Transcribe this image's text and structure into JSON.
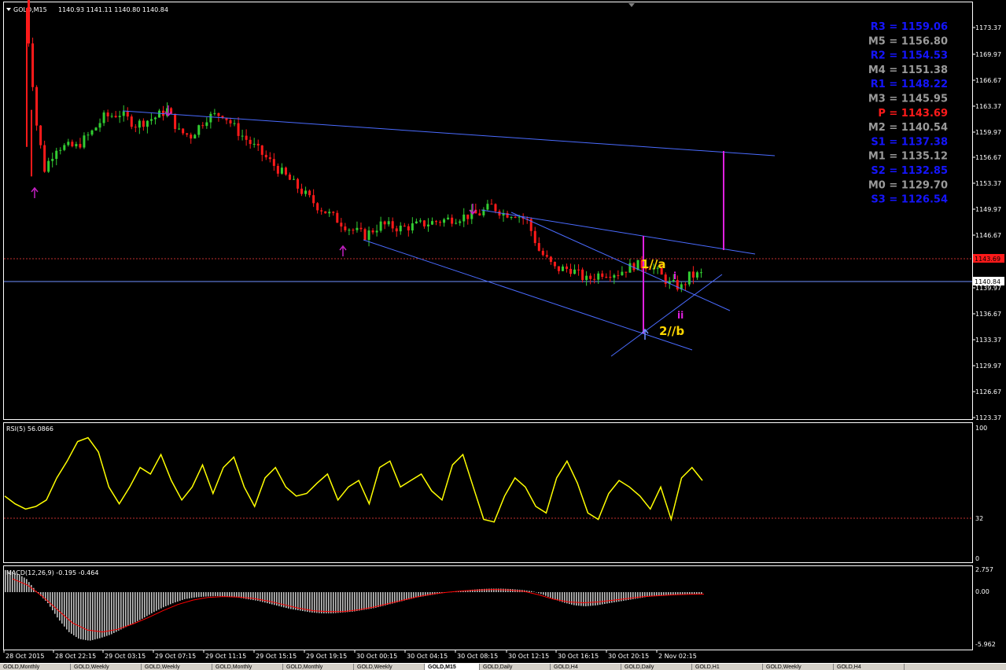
{
  "header": {
    "symbol": "GOLD,M15",
    "ohlc": "1140.93 1141.11 1140.80 1140.84"
  },
  "colors": {
    "background": "#000000",
    "grid_frame": "#ffffff",
    "bull": "#32cd32",
    "bear": "#ff1a1a",
    "trendline": "#4a6bff",
    "magenta": "#e020e0",
    "yellow_label": "#ffd700",
    "pivot_blue": "#1515ff",
    "pivot_gray": "#9a9a9a",
    "pivot_red": "#ff1a1a",
    "rsi": "#ffff00",
    "macd_hist": "#c0c0c0",
    "macd_signal": "#ff0000",
    "price_line": "#6f8fff",
    "level_dotted": "#c03030"
  },
  "pivots": [
    {
      "label": "R3",
      "value": "1159.06",
      "color": "blue"
    },
    {
      "label": "M5",
      "value": "1156.80",
      "color": "gray"
    },
    {
      "label": "R2",
      "value": "1154.53",
      "color": "blue"
    },
    {
      "label": "M4",
      "value": "1151.38",
      "color": "gray"
    },
    {
      "label": "R1",
      "value": "1148.22",
      "color": "blue"
    },
    {
      "label": "M3",
      "value": "1145.95",
      "color": "gray"
    },
    {
      "label": "P ",
      "value": "1143.69",
      "color": "red"
    },
    {
      "label": "M2",
      "value": "1140.54",
      "color": "gray"
    },
    {
      "label": "S1",
      "value": "1137.38",
      "color": "blue"
    },
    {
      "label": "M1",
      "value": "1135.12",
      "color": "gray"
    },
    {
      "label": "S2",
      "value": "1132.85",
      "color": "blue"
    },
    {
      "label": "M0",
      "value": "1129.70",
      "color": "gray"
    },
    {
      "label": "S3",
      "value": "1126.54",
      "color": "blue"
    }
  ],
  "price_axis": {
    "ticks": [
      "1173.37",
      "1169.97",
      "1166.67",
      "1163.37",
      "1159.97",
      "1156.67",
      "1153.37",
      "1149.97",
      "1146.67",
      "1139.97",
      "1136.67",
      "1133.37",
      "1129.97",
      "1126.67",
      "1123.37"
    ],
    "current_price": "1140.84",
    "marker_price": "1143.69"
  },
  "time_axis": {
    "labels": [
      "28 Oct 2015",
      "28 Oct 22:15",
      "29 Oct 03:15",
      "29 Oct 07:15",
      "29 Oct 11:15",
      "29 Oct 15:15",
      "29 Oct 19:15",
      "30 Oct 00:15",
      "30 Oct 04:15",
      "30 Oct 08:15",
      "30 Oct 12:15",
      "30 Oct 16:15",
      "30 Oct 20:15",
      "2 Nov 02:15"
    ]
  },
  "wave_labels": {
    "w1": "1//a",
    "w2": "2//b",
    "wi": "i",
    "wii": "ii"
  },
  "rsi": {
    "title": "RSI(5) 56.0866",
    "levels": [
      "100",
      "32",
      "0"
    ]
  },
  "macd": {
    "title": "MACD(12,26,9) -0.195 -0.464",
    "levels": [
      "2.757",
      "0.00",
      "-5.962"
    ]
  },
  "tabs": [
    "GOLD,Monthly",
    "GOLD,Weekly",
    "GOLD,Weekly",
    "GOLD,Monthly",
    "GOLD,Monthly",
    "GOLD,Weekly",
    "GOLD,M15",
    "GOLD,Daily",
    "GOLD,H4",
    "GOLD,Daily",
    "GOLD,H1",
    "GOLD,Weekly",
    "GOLD,H4"
  ],
  "active_tab": 6,
  "chart_data": {
    "type": "candlestick",
    "price_path": [
      [
        0,
        1178
      ],
      [
        3,
        1161
      ],
      [
        5,
        1155
      ],
      [
        8,
        1158
      ],
      [
        13,
        1158
      ],
      [
        17,
        1160
      ],
      [
        20,
        1162
      ],
      [
        24,
        1162.5
      ],
      [
        28,
        1161
      ],
      [
        33,
        1162
      ],
      [
        36,
        1163
      ],
      [
        39,
        1160
      ],
      [
        42,
        1159.5
      ],
      [
        46,
        1162
      ],
      [
        50,
        1162.5
      ],
      [
        54,
        1160
      ],
      [
        58,
        1158
      ],
      [
        62,
        1156
      ],
      [
        66,
        1154
      ],
      [
        70,
        1152
      ],
      [
        74,
        1150
      ],
      [
        78,
        1148.5
      ],
      [
        82,
        1147
      ],
      [
        86,
        1146
      ],
      [
        90,
        1147.5
      ],
      [
        95,
        1147
      ],
      [
        100,
        1147.5
      ],
      [
        105,
        1148
      ],
      [
        110,
        1148.5
      ],
      [
        115,
        1149
      ],
      [
        118,
        1150
      ],
      [
        121,
        1149
      ],
      [
        124,
        1149
      ],
      [
        127,
        1148
      ],
      [
        130,
        1144
      ],
      [
        134,
        1141.5
      ],
      [
        138,
        1141.5
      ],
      [
        142,
        1140
      ],
      [
        146,
        1141
      ],
      [
        150,
        1141
      ],
      [
        154,
        1142
      ],
      [
        158,
        1142
      ],
      [
        161,
        1140.5
      ],
      [
        163,
        1139.5
      ],
      [
        166,
        1139
      ],
      [
        168,
        1140.5
      ],
      [
        172,
        1140.84
      ]
    ],
    "price_range": [
      1121.5,
      1177
    ],
    "rsi_values": [
      48,
      42,
      38,
      40,
      45,
      62,
      75,
      90,
      93,
      82,
      55,
      42,
      55,
      70,
      65,
      80,
      60,
      45,
      55,
      72,
      50,
      70,
      78,
      55,
      40,
      62,
      70,
      55,
      48,
      50,
      58,
      65,
      45,
      55,
      60,
      42,
      70,
      75,
      55,
      60,
      65,
      52,
      45,
      72,
      80,
      55,
      30,
      28,
      48,
      62,
      55,
      40,
      35,
      62,
      75,
      58,
      35,
      30,
      50,
      60,
      55,
      48,
      38,
      55,
      30,
      62,
      70,
      60
    ],
    "rsi_range": [
      0,
      100
    ],
    "macd_hist": [
      2.5,
      2.2,
      1.5,
      0,
      -1.2,
      -3,
      -4.5,
      -5.3,
      -5.5,
      -5.2,
      -4.8,
      -4.2,
      -3.6,
      -3,
      -2.3,
      -1.7,
      -1.2,
      -0.8,
      -0.6,
      -0.5,
      -0.45,
      -0.5,
      -0.6,
      -0.8,
      -1,
      -1.3,
      -1.6,
      -1.9,
      -2.1,
      -2.3,
      -2.4,
      -2.4,
      -2.3,
      -2.2,
      -2,
      -1.8,
      -1.5,
      -1.2,
      -0.9,
      -0.6,
      -0.4,
      -0.2,
      0,
      0.1,
      0.25,
      0.35,
      0.4,
      0.4,
      0.35,
      0.25,
      0.1,
      -0.3,
      -0.8,
      -1.2,
      -1.5,
      -1.6,
      -1.5,
      -1.3,
      -1.1,
      -0.9,
      -0.7,
      -0.5,
      -0.4,
      -0.35,
      -0.3,
      -0.25,
      -0.2
    ],
    "macd_signal": [
      1.5,
      0.8,
      -0.5,
      -2,
      -3.5,
      -4.3,
      -4.5,
      -4.2,
      -3.6,
      -2.9,
      -2.1,
      -1.4,
      -0.9,
      -0.6,
      -0.5,
      -0.55,
      -0.7,
      -1,
      -1.4,
      -1.8,
      -2.1,
      -2.2,
      -2.2,
      -2,
      -1.7,
      -1.3,
      -0.9,
      -0.5,
      -0.2,
      0,
      0.15,
      0.25,
      0.3,
      0.25,
      0.1,
      -0.3,
      -0.8,
      -1.1,
      -1.2,
      -1.1,
      -0.9,
      -0.7,
      -0.5,
      -0.4,
      -0.3,
      -0.25,
      -0.22
    ],
    "macd_range": [
      -5.962,
      2.757
    ]
  }
}
